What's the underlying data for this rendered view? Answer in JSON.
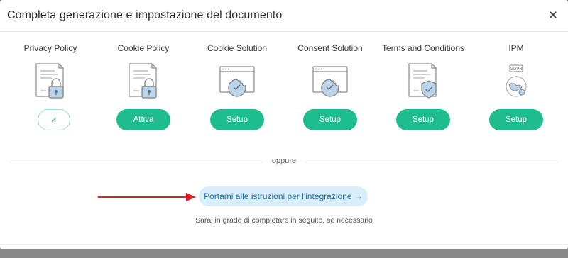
{
  "modal": {
    "title": "Completa generazione e impostazione del documento"
  },
  "products": [
    {
      "label": "Privacy Policy",
      "icon": "document-lock-icon",
      "button": "✓",
      "state": "done"
    },
    {
      "label": "Cookie Policy",
      "icon": "document-lock-icon",
      "button": "Attiva",
      "state": "action"
    },
    {
      "label": "Cookie Solution",
      "icon": "browser-cookie-icon",
      "button": "Setup",
      "state": "action"
    },
    {
      "label": "Consent Solution",
      "icon": "browser-cookie-icon",
      "button": "Setup",
      "state": "action"
    },
    {
      "label": "Terms and Conditions",
      "icon": "document-shield-icon",
      "button": "Setup",
      "state": "action"
    },
    {
      "label": "IPM",
      "icon": "gdpr-globe-icon",
      "button": "Setup",
      "state": "action",
      "badge": "GDPR"
    }
  ],
  "divider_label": "oppure",
  "integration": {
    "button": "Portami alle istruzioni per l'integrazione →",
    "hint": "Sarai in grado di completare in seguito, se necessario"
  },
  "colors": {
    "accent": "#1fbd8d",
    "link_bg": "#d8eefa",
    "link_text": "#1f6fa6",
    "arrow": "#e02020",
    "icon_blue": "#bcd4ea"
  }
}
